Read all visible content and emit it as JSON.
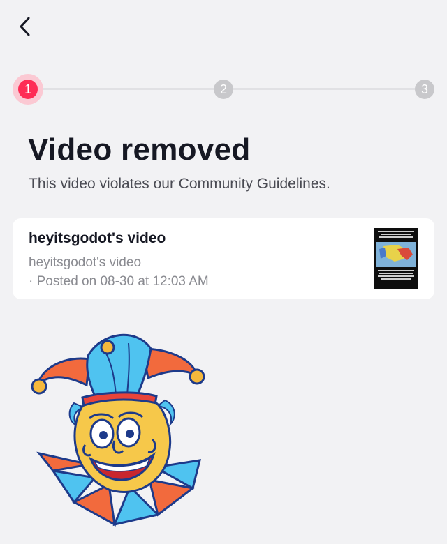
{
  "header": {
    "back_icon": "chevron-left-icon"
  },
  "stepper": {
    "steps": [
      "1",
      "2",
      "3"
    ],
    "active_step": 1,
    "active_color": "#fe2c55",
    "inactive_color": "#c8c8cb"
  },
  "main": {
    "title": "Video removed",
    "subtitle": "This video violates our Community Guidelines."
  },
  "video_card": {
    "title": "heyitsgodot's video",
    "description": "heyitsgodot's video",
    "posted": "· Posted on 08-30 at 12:03 AM"
  },
  "illustration": {
    "icon": "jester-icon"
  }
}
